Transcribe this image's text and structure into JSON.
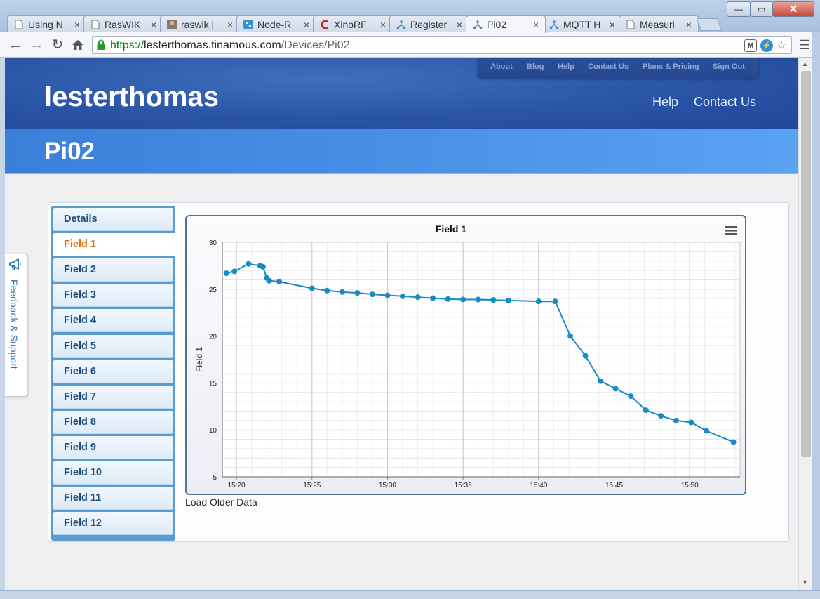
{
  "browser": {
    "tabs": [
      {
        "title": "Using N",
        "icon": "page-icon"
      },
      {
        "title": "RasWIK",
        "icon": "page-icon"
      },
      {
        "title": "raswik |",
        "icon": "profile-photo-icon"
      },
      {
        "title": "Node-R",
        "icon": "node-red-icon"
      },
      {
        "title": "XinoRF",
        "icon": "ciseco-icon"
      },
      {
        "title": "Register",
        "icon": "tinamous-icon"
      },
      {
        "title": "Pi02",
        "icon": "tinamous-icon"
      },
      {
        "title": "MQTT H",
        "icon": "tinamous-icon"
      },
      {
        "title": "Measuri",
        "icon": "page-icon"
      }
    ],
    "active_tab": 6,
    "url_scheme": "https://",
    "url_host": "lesterthomas.tinamous.com",
    "url_path": "/Devices/Pi02"
  },
  "site": {
    "brand": "lesterthomas",
    "top_nav": [
      "About",
      "Blog",
      "Help",
      "Contact Us",
      "Plans & Pricing",
      "Sign Out"
    ],
    "main_nav": [
      "Help",
      "Contact Us"
    ],
    "page_title": "Pi02",
    "feedback_label": "Feedback & Support"
  },
  "field_tabs": [
    "Details",
    "Field 1",
    "Field 2",
    "Field 3",
    "Field 4",
    "Field 5",
    "Field 6",
    "Field 7",
    "Field 8",
    "Field 9",
    "Field 10",
    "Field 11",
    "Field 12"
  ],
  "active_field_tab": 1,
  "load_older_label": "Load Older Data",
  "colors": {
    "series": "#1a8ac6",
    "active_tab_text": "#e07316",
    "header_blue": "#2a54a6"
  },
  "chart_data": {
    "type": "line",
    "title": "Field 1",
    "xlabel": "",
    "ylabel": "Field 1",
    "ylim": [
      5,
      30
    ],
    "yticks": [
      5,
      10,
      15,
      20,
      25,
      30
    ],
    "xlim": [
      "15:19:04",
      "15:53:20"
    ],
    "xticks": [
      "15:20",
      "15:25",
      "15:30",
      "15:35",
      "15:40",
      "15:45",
      "15:50"
    ],
    "grid": true,
    "legend": "none",
    "series": [
      {
        "x": [
          "15:19:20",
          "15:19:52",
          "15:20:48",
          "15:21:34",
          "15:21:45",
          "15:22:00",
          "15:22:10",
          "15:22:50",
          "15:25:00",
          "15:26:00",
          "15:27:00",
          "15:28:00",
          "15:29:00",
          "15:30:00",
          "15:31:00",
          "15:32:00",
          "15:33:00",
          "15:34:00",
          "15:35:00",
          "15:36:00",
          "15:37:00",
          "15:38:00",
          "15:40:00",
          "15:41:06",
          "15:42:06",
          "15:43:06",
          "15:44:06",
          "15:45:06",
          "15:46:06",
          "15:47:06",
          "15:48:06",
          "15:49:06",
          "15:50:06",
          "15:51:06",
          "15:52:54"
        ],
        "values": [
          26.7,
          26.9,
          27.7,
          27.5,
          27.4,
          26.2,
          25.9,
          25.8,
          25.1,
          24.85,
          24.7,
          24.6,
          24.45,
          24.35,
          24.25,
          24.15,
          24.05,
          23.95,
          23.9,
          23.9,
          23.85,
          23.8,
          23.7,
          23.7,
          20.0,
          17.9,
          15.2,
          14.4,
          13.6,
          12.1,
          11.5,
          11.0,
          10.8,
          9.9,
          8.7
        ]
      }
    ]
  }
}
